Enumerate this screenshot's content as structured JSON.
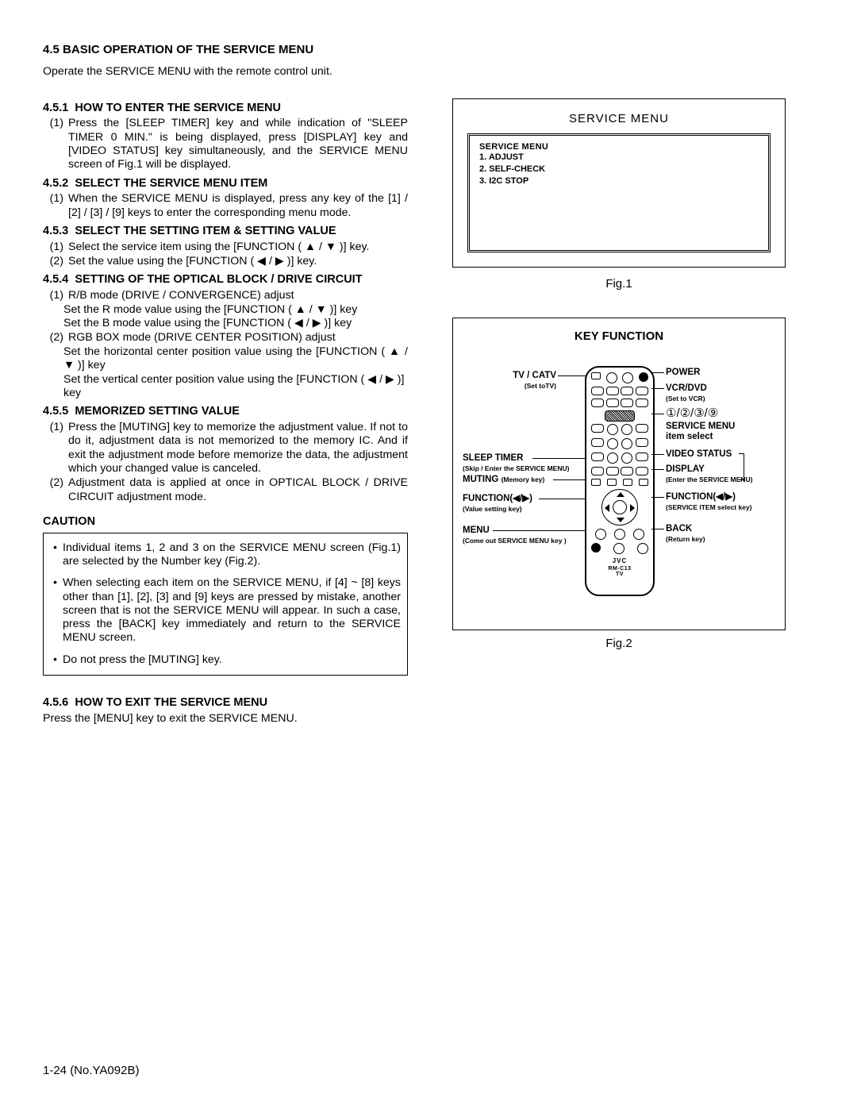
{
  "section_no": "4.5",
  "section_title": "BASIC OPERATION OF THE SERVICE MENU",
  "intro": "Operate the SERVICE MENU with the remote control unit.",
  "s451": {
    "no": "4.5.1",
    "title": "HOW TO ENTER THE SERVICE MENU",
    "item1": "Press the [SLEEP TIMER] key and while indication of \"SLEEP TIMER 0 MIN.\" is being displayed, press [DISPLAY] key and [VIDEO STATUS] key simultaneously, and the SERVICE MENU screen of Fig.1 will be displayed."
  },
  "s452": {
    "no": "4.5.2",
    "title": "SELECT THE SERVICE MENU ITEM",
    "item1": "When the SERVICE MENU is displayed, press any key of the [1] / [2] / [3] / [9] keys to enter the corresponding menu mode."
  },
  "s453": {
    "no": "4.5.3",
    "title": "SELECT THE SETTING ITEM & SETTING VALUE",
    "item1": "Select the service item using the [FUNCTION ( ▲ / ▼ )] key.",
    "item2": "Set the value using the [FUNCTION ( ◀ / ▶ )] key."
  },
  "s454": {
    "no": "4.5.4",
    "title": "SETTING OF THE OPTICAL BLOCK / DRIVE CIRCUIT",
    "item1": "R/B mode (DRIVE / CONVERGENCE) adjust",
    "item1a": "Set the R mode value using the [FUNCTION ( ▲ / ▼ )] key",
    "item1b": "Set the B mode  value using the [FUNCTION ( ◀ / ▶ )] key",
    "item2": "RGB BOX mode (DRIVE CENTER POSITION) adjust",
    "item2a": "Set the horizontal center position value using the [FUNCTION ( ▲ / ▼ )] key",
    "item2b": "Set the vertical center position value using the [FUNCTION ( ◀ / ▶ )] key"
  },
  "s455": {
    "no": "4.5.5",
    "title": "MEMORIZED SETTING VALUE",
    "item1": "Press the [MUTING] key to memorize the adjustment value. If not to do it, adjustment data is not memorized to the memory IC. And if exit the adjustment mode before memorize the data, the adjustment which your changed value is canceled.",
    "item2": "Adjustment data is applied at once in OPTICAL BLOCK / DRIVE CIRCUIT adjustment mode."
  },
  "caution_label": "CAUTION",
  "caution": {
    "b1": "Individual items 1, 2 and 3 on the SERVICE MENU screen (Fig.1) are selected by the Number key (Fig.2).",
    "b2": "When selecting each item on the SERVICE MENU, if [4] ~ [8] keys other than [1], [2], [3] and [9] keys are pressed by mistake, another screen that is not the SERVICE MENU will appear. In such a case, press the [BACK] key immediately and return to the SERVICE MENU screen.",
    "b3": "Do not press the [MUTING] key."
  },
  "s456": {
    "no": "4.5.6",
    "title": "HOW TO EXIT THE SERVICE MENU",
    "text": "Press the [MENU] key to exit the SERVICE MENU."
  },
  "fig1": {
    "box_title": "SERVICE MENU",
    "menu_title": "SERVICE MENU",
    "line1": "1. ADJUST",
    "line2": "2. SELF-CHECK",
    "line3": "3. I2C  STOP",
    "caption": "Fig.1"
  },
  "fig2": {
    "title": "KEY FUNCTION",
    "tvcatv": "TV / CATV",
    "tvcatv_s": "(Set toTV)",
    "sleep": "SLEEP TIMER",
    "sleep_s": "(Skip / Enter the SERVICE MENU)",
    "muting": "MUTING",
    "muting_s": "(Memory key)",
    "funcL": "FUNCTION(◀/▶)",
    "funcL_s": "(Value setting key)",
    "menu": "MENU",
    "menu_s": "(Come out SERVICE MENU key )",
    "power": "POWER",
    "vcrdvd": "VCR/DVD",
    "vcrdvd_s": "(Set to VCR)",
    "numbers": "①/②/③/⑨",
    "srvmenu1": "SERVICE MENU",
    "srvmenu2": "item select",
    "videostatus": "VIDEO STATUS",
    "display": "DISPLAY",
    "display_s": "(Enter the SERVICE MENU)",
    "funcR": "FUNCTION(◀/▶)",
    "funcR_s": "(SERVICE ITEM select key)",
    "back": "BACK",
    "back_s": "(Return key)",
    "brand": "JVC",
    "caption": "Fig.2"
  },
  "footer": "1-24 (No.YA092B)"
}
